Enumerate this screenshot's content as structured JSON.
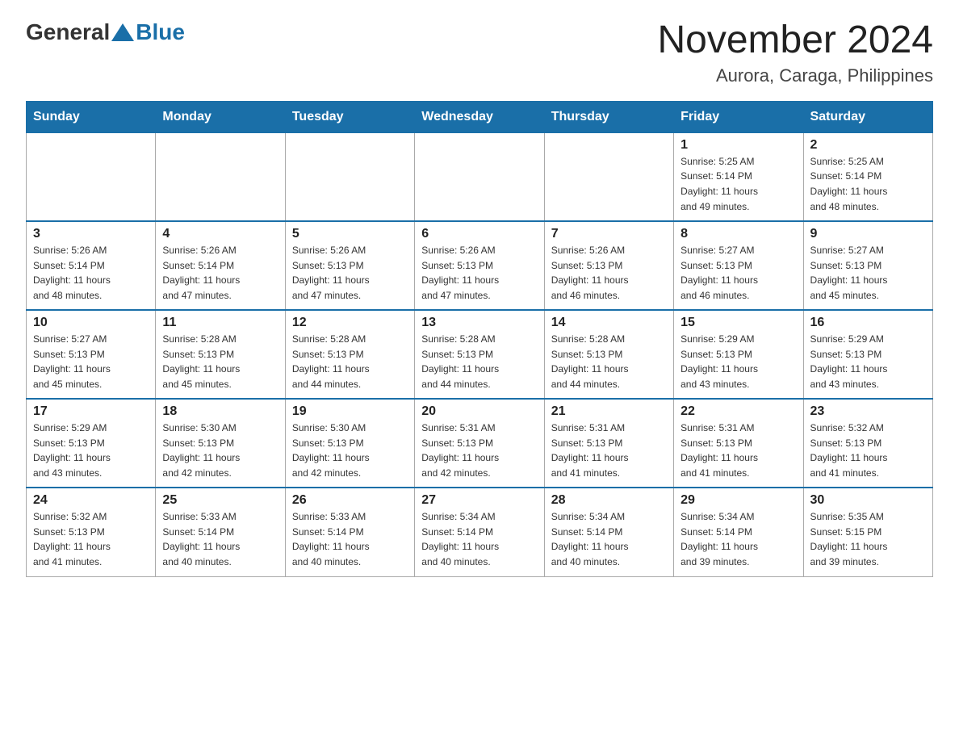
{
  "header": {
    "logo": {
      "general": "General",
      "blue": "Blue"
    },
    "title": "November 2024",
    "location": "Aurora, Caraga, Philippines"
  },
  "calendar": {
    "days_of_week": [
      "Sunday",
      "Monday",
      "Tuesday",
      "Wednesday",
      "Thursday",
      "Friday",
      "Saturday"
    ],
    "weeks": [
      [
        {
          "day": "",
          "info": ""
        },
        {
          "day": "",
          "info": ""
        },
        {
          "day": "",
          "info": ""
        },
        {
          "day": "",
          "info": ""
        },
        {
          "day": "",
          "info": ""
        },
        {
          "day": "1",
          "info": "Sunrise: 5:25 AM\nSunset: 5:14 PM\nDaylight: 11 hours\nand 49 minutes."
        },
        {
          "day": "2",
          "info": "Sunrise: 5:25 AM\nSunset: 5:14 PM\nDaylight: 11 hours\nand 48 minutes."
        }
      ],
      [
        {
          "day": "3",
          "info": "Sunrise: 5:26 AM\nSunset: 5:14 PM\nDaylight: 11 hours\nand 48 minutes."
        },
        {
          "day": "4",
          "info": "Sunrise: 5:26 AM\nSunset: 5:14 PM\nDaylight: 11 hours\nand 47 minutes."
        },
        {
          "day": "5",
          "info": "Sunrise: 5:26 AM\nSunset: 5:13 PM\nDaylight: 11 hours\nand 47 minutes."
        },
        {
          "day": "6",
          "info": "Sunrise: 5:26 AM\nSunset: 5:13 PM\nDaylight: 11 hours\nand 47 minutes."
        },
        {
          "day": "7",
          "info": "Sunrise: 5:26 AM\nSunset: 5:13 PM\nDaylight: 11 hours\nand 46 minutes."
        },
        {
          "day": "8",
          "info": "Sunrise: 5:27 AM\nSunset: 5:13 PM\nDaylight: 11 hours\nand 46 minutes."
        },
        {
          "day": "9",
          "info": "Sunrise: 5:27 AM\nSunset: 5:13 PM\nDaylight: 11 hours\nand 45 minutes."
        }
      ],
      [
        {
          "day": "10",
          "info": "Sunrise: 5:27 AM\nSunset: 5:13 PM\nDaylight: 11 hours\nand 45 minutes."
        },
        {
          "day": "11",
          "info": "Sunrise: 5:28 AM\nSunset: 5:13 PM\nDaylight: 11 hours\nand 45 minutes."
        },
        {
          "day": "12",
          "info": "Sunrise: 5:28 AM\nSunset: 5:13 PM\nDaylight: 11 hours\nand 44 minutes."
        },
        {
          "day": "13",
          "info": "Sunrise: 5:28 AM\nSunset: 5:13 PM\nDaylight: 11 hours\nand 44 minutes."
        },
        {
          "day": "14",
          "info": "Sunrise: 5:28 AM\nSunset: 5:13 PM\nDaylight: 11 hours\nand 44 minutes."
        },
        {
          "day": "15",
          "info": "Sunrise: 5:29 AM\nSunset: 5:13 PM\nDaylight: 11 hours\nand 43 minutes."
        },
        {
          "day": "16",
          "info": "Sunrise: 5:29 AM\nSunset: 5:13 PM\nDaylight: 11 hours\nand 43 minutes."
        }
      ],
      [
        {
          "day": "17",
          "info": "Sunrise: 5:29 AM\nSunset: 5:13 PM\nDaylight: 11 hours\nand 43 minutes."
        },
        {
          "day": "18",
          "info": "Sunrise: 5:30 AM\nSunset: 5:13 PM\nDaylight: 11 hours\nand 42 minutes."
        },
        {
          "day": "19",
          "info": "Sunrise: 5:30 AM\nSunset: 5:13 PM\nDaylight: 11 hours\nand 42 minutes."
        },
        {
          "day": "20",
          "info": "Sunrise: 5:31 AM\nSunset: 5:13 PM\nDaylight: 11 hours\nand 42 minutes."
        },
        {
          "day": "21",
          "info": "Sunrise: 5:31 AM\nSunset: 5:13 PM\nDaylight: 11 hours\nand 41 minutes."
        },
        {
          "day": "22",
          "info": "Sunrise: 5:31 AM\nSunset: 5:13 PM\nDaylight: 11 hours\nand 41 minutes."
        },
        {
          "day": "23",
          "info": "Sunrise: 5:32 AM\nSunset: 5:13 PM\nDaylight: 11 hours\nand 41 minutes."
        }
      ],
      [
        {
          "day": "24",
          "info": "Sunrise: 5:32 AM\nSunset: 5:13 PM\nDaylight: 11 hours\nand 41 minutes."
        },
        {
          "day": "25",
          "info": "Sunrise: 5:33 AM\nSunset: 5:14 PM\nDaylight: 11 hours\nand 40 minutes."
        },
        {
          "day": "26",
          "info": "Sunrise: 5:33 AM\nSunset: 5:14 PM\nDaylight: 11 hours\nand 40 minutes."
        },
        {
          "day": "27",
          "info": "Sunrise: 5:34 AM\nSunset: 5:14 PM\nDaylight: 11 hours\nand 40 minutes."
        },
        {
          "day": "28",
          "info": "Sunrise: 5:34 AM\nSunset: 5:14 PM\nDaylight: 11 hours\nand 40 minutes."
        },
        {
          "day": "29",
          "info": "Sunrise: 5:34 AM\nSunset: 5:14 PM\nDaylight: 11 hours\nand 39 minutes."
        },
        {
          "day": "30",
          "info": "Sunrise: 5:35 AM\nSunset: 5:15 PM\nDaylight: 11 hours\nand 39 minutes."
        }
      ]
    ]
  }
}
